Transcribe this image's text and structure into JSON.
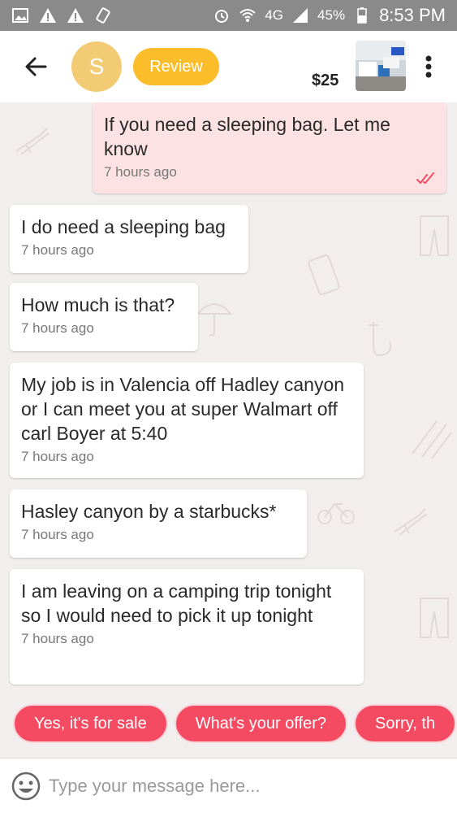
{
  "status_bar": {
    "battery": "45%",
    "time": "8:53 PM",
    "network": "4G",
    "icons": [
      "image-icon",
      "warning-icon",
      "warning-icon",
      "vibrate-icon",
      "alarm-icon",
      "wifi-icon",
      "signal-icon",
      "battery-icon"
    ]
  },
  "header": {
    "avatar_letter": "S",
    "review_label": "Review",
    "price": "$25",
    "colors": {
      "avatar": "#f3cb74",
      "review": "#fbbd2a"
    }
  },
  "messages": [
    {
      "direction": "out",
      "text": "If you need a sleeping bag. Let me know",
      "time": "7 hours ago",
      "read": true
    },
    {
      "direction": "in",
      "text": "I do need a sleeping bag",
      "time": "7 hours ago"
    },
    {
      "direction": "in",
      "text": "How much is that?",
      "time": "7 hours ago"
    },
    {
      "direction": "in",
      "text": "My job is in Valencia off Hadley canyon or I can meet you at super Walmart off carl Boyer at 5:40",
      "time": "7 hours ago"
    },
    {
      "direction": "in",
      "text": "Hasley canyon by a starbucks*",
      "time": "7 hours ago"
    },
    {
      "direction": "in",
      "text": "I am leaving on a camping trip tonight so I would need to pick it up tonight",
      "time": "7 hours ago"
    }
  ],
  "quick_replies": [
    "Yes, it's for sale",
    "What's your offer?",
    "Sorry, th"
  ],
  "composer": {
    "placeholder": "Type your message here..."
  },
  "colors": {
    "accent": "#f44b63",
    "outgoing_bubble": "#fde2e4",
    "background": "#f2eeee"
  }
}
